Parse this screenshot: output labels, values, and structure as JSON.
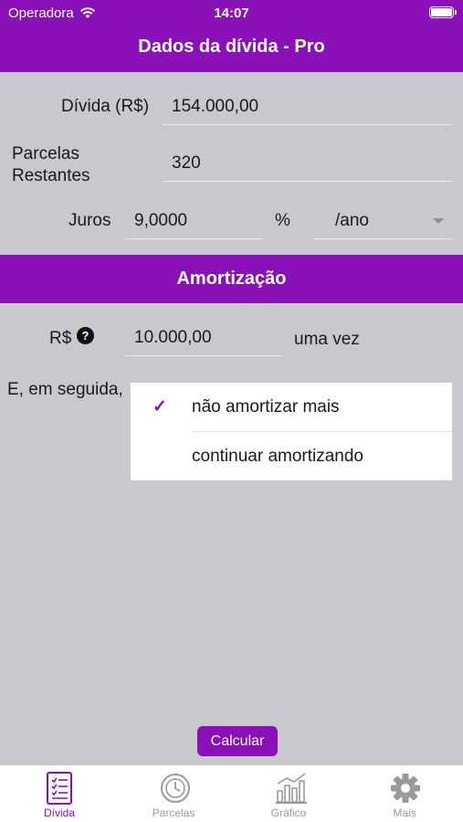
{
  "status_bar": {
    "carrier": "Operadora",
    "time": "14:07"
  },
  "header": {
    "title": "Dados da dívida - Pro"
  },
  "form": {
    "divida_label": "Dívida (R$)",
    "divida_value": "154.000,00",
    "parcelas_label_1": "Parcelas",
    "parcelas_label_2": "Restantes",
    "parcelas_value": "320",
    "juros_label": "Juros",
    "juros_value": "9,0000",
    "juros_unit": "%",
    "juros_period": "/ano"
  },
  "amortizacao": {
    "section_title": "Amortização",
    "currency_label": "R$",
    "help_icon_glyph": "?",
    "amount_value": "10.000,00",
    "frequency": "uma vez",
    "then_label": "E, em seguida,",
    "options": [
      {
        "label": "não amortizar mais",
        "selected": true
      },
      {
        "label": "continuar amortizando",
        "selected": false
      }
    ],
    "check_glyph": "✓"
  },
  "calcular_button": "Calcular",
  "tabbar": {
    "tabs": [
      {
        "label": "Dívida",
        "icon": "list-icon",
        "active": true
      },
      {
        "label": "Parcelas",
        "icon": "clock-icon",
        "active": false
      },
      {
        "label": "Gráfico",
        "icon": "bar-chart-icon",
        "active": false
      },
      {
        "label": "Mais",
        "icon": "gear-icon",
        "active": false
      }
    ]
  },
  "colors": {
    "accent": "#8a10b8",
    "background": "#c8c9cc"
  }
}
